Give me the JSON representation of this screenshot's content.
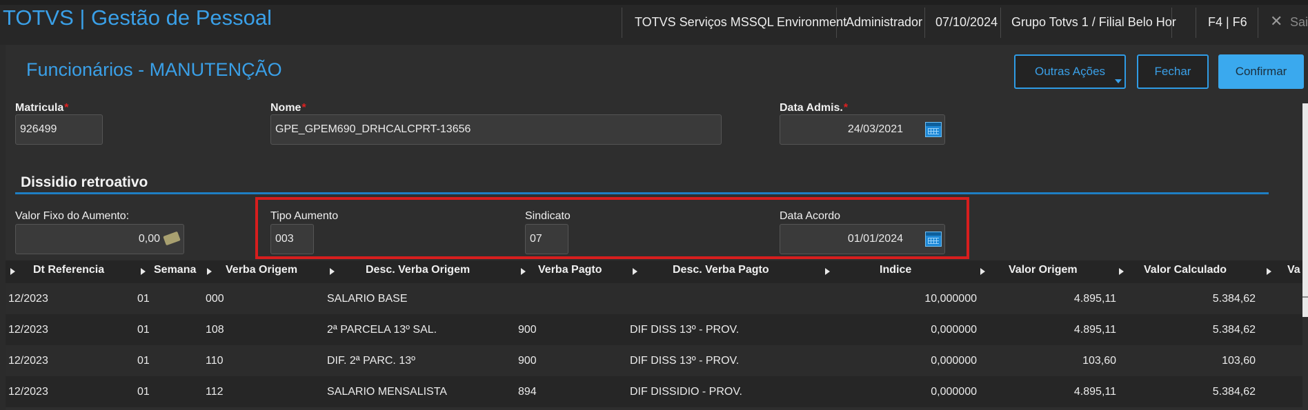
{
  "topbar": {
    "app_title": "TOTVS | Gestão de Pessoal",
    "environment": "TOTVS Serviços MSSQL Environment",
    "user": "Administrador",
    "date": "07/10/2024",
    "branch": "Grupo Totvs 1 / Filial Belo Hor",
    "shortcuts": "F4 | F6",
    "exit_label": "Sair"
  },
  "form": {
    "title": "Funcionários - MANUTENÇÃO",
    "buttons": {
      "other_actions": "Outras Ações",
      "close": "Fechar",
      "confirm": "Confirmar"
    },
    "matricula": {
      "label": "Matricula",
      "value": "926499"
    },
    "nome": {
      "label": "Nome",
      "value": "GPE_GPEM690_DRHCALCPRT-13656"
    },
    "data_admis": {
      "label": "Data Admis.",
      "value": "24/03/2021"
    },
    "required_mark": "*"
  },
  "section": {
    "title": "Dissidio retroativo",
    "valor_fixo": {
      "label": "Valor Fixo do Aumento:",
      "value": "0,00"
    },
    "tipo_aumento": {
      "label": "Tipo Aumento",
      "value": "003"
    },
    "sindicato": {
      "label": "Sindicato",
      "value": "07"
    },
    "data_acordo": {
      "label": "Data Acordo",
      "value": "01/01/2024"
    }
  },
  "grid": {
    "columns": [
      "Dt Referencia",
      "Semana",
      "Verba Origem",
      "Desc. Verba Origem",
      "Verba Pagto",
      "Desc. Verba Pagto",
      "Indice",
      "Valor Origem",
      "Valor Calculado",
      "Va"
    ],
    "rows": [
      [
        "12/2023",
        "01",
        "000",
        "SALARIO BASE",
        "",
        "",
        "10,000000",
        "4.895,11",
        "5.384,62"
      ],
      [
        "12/2023",
        "01",
        "108",
        "2ª PARCELA 13º SAL.",
        "900",
        "DIF DISS 13º - PROV.",
        "0,000000",
        "4.895,11",
        "5.384,62"
      ],
      [
        "12/2023",
        "01",
        "110",
        "DIF. 2ª PARC. 13º",
        "900",
        "DIF DISS 13º - PROV.",
        "0,000000",
        "103,60",
        "103,60"
      ],
      [
        "12/2023",
        "01",
        "112",
        "SALARIO MENSALISTA",
        "894",
        "DIF DISSIDIO - PROV.",
        "0,000000",
        "4.895,11",
        "5.384,62"
      ]
    ]
  },
  "colors": {
    "accent": "#3aa0e8",
    "highlight": "#d71e1e",
    "background": "#2b2b2b"
  }
}
